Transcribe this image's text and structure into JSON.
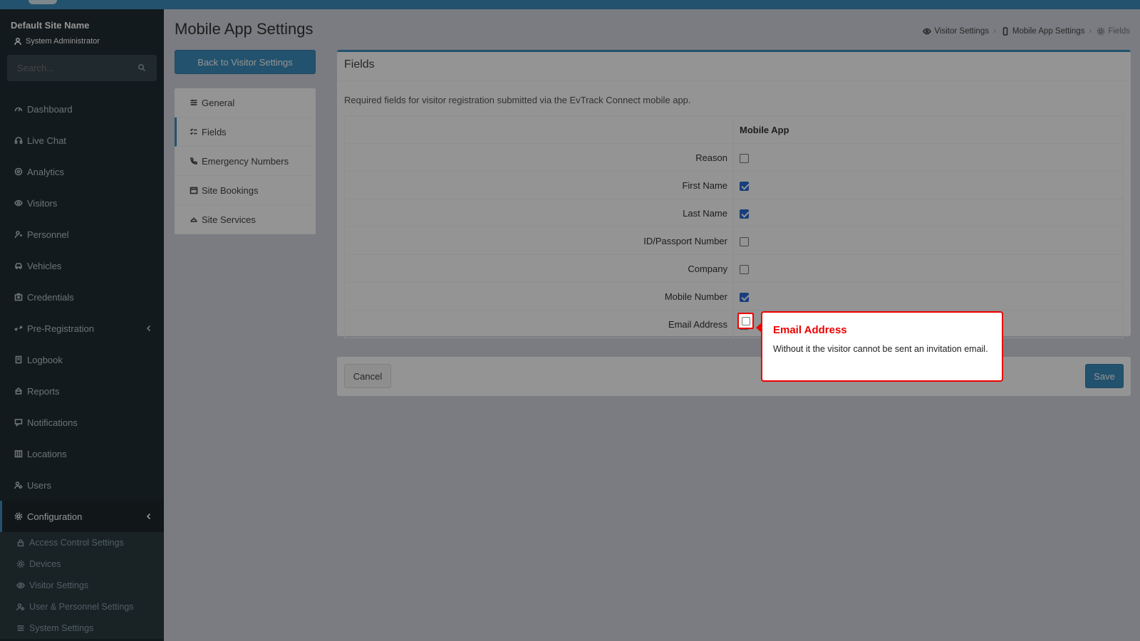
{
  "sidebar": {
    "site_name": "Default Site Name",
    "role": "System Administrator",
    "search_placeholder": "Search...",
    "items": [
      {
        "label": "Dashboard"
      },
      {
        "label": "Live Chat"
      },
      {
        "label": "Analytics"
      },
      {
        "label": "Visitors"
      },
      {
        "label": "Personnel"
      },
      {
        "label": "Vehicles"
      },
      {
        "label": "Credentials"
      },
      {
        "label": "Pre-Registration"
      },
      {
        "label": "Logbook"
      },
      {
        "label": "Reports"
      },
      {
        "label": "Notifications"
      },
      {
        "label": "Locations"
      },
      {
        "label": "Users"
      },
      {
        "label": "Configuration"
      }
    ],
    "submenu": [
      {
        "label": "Access Control Settings"
      },
      {
        "label": "Devices"
      },
      {
        "label": "Visitor Settings"
      },
      {
        "label": "User & Personnel Settings"
      },
      {
        "label": "System Settings"
      }
    ]
  },
  "header": {
    "title": "Mobile App Settings",
    "breadcrumb": [
      "Visitor Settings",
      "Mobile App Settings",
      "Fields"
    ]
  },
  "back_button": "Back to Visitor Settings",
  "subnav": [
    {
      "label": "General"
    },
    {
      "label": "Fields"
    },
    {
      "label": "Emergency Numbers"
    },
    {
      "label": "Site Bookings"
    },
    {
      "label": "Site Services"
    }
  ],
  "fields_box": {
    "title": "Fields",
    "description": "Required fields for visitor registration submitted via the EvTrack Connect mobile app.",
    "column_header": "Mobile App",
    "rows": [
      {
        "label": "Reason",
        "checked": false
      },
      {
        "label": "First Name",
        "checked": true
      },
      {
        "label": "Last Name",
        "checked": true
      },
      {
        "label": "ID/Passport Number",
        "checked": false
      },
      {
        "label": "Company",
        "checked": false
      },
      {
        "label": "Mobile Number",
        "checked": true
      },
      {
        "label": "Email Address",
        "checked": false
      }
    ]
  },
  "footer": {
    "cancel": "Cancel",
    "save": "Save"
  },
  "tooltip": {
    "title": "Email Address",
    "body": "Without it the visitor cannot be sent an invitation email."
  },
  "colors": {
    "accent": "#3c8dbc",
    "sidebar": "#222d32",
    "highlight": "#e00000",
    "checkbox": "#2a6bd6"
  }
}
